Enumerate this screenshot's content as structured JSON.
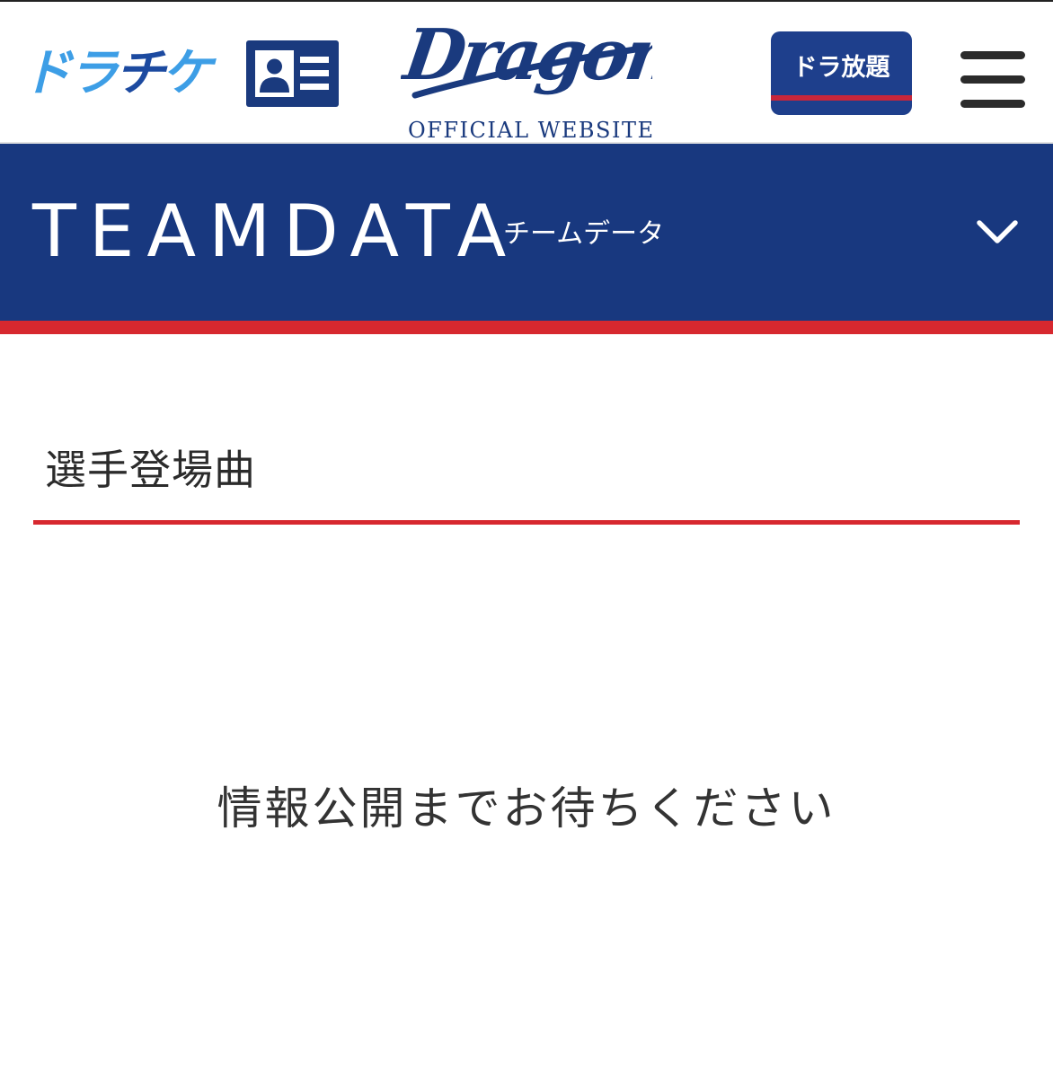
{
  "header": {
    "dorachike_logo": {
      "part1": "ドラ",
      "part2": "チ",
      "part3": "ケ"
    },
    "member_card_icon": "member-card-icon",
    "brand_logo": {
      "script_text": "Dragons",
      "tagline": "OFFICIAL WEBSITE"
    },
    "dora_houdai_label": "ドラ放題",
    "menu_icon": "hamburger-menu-icon"
  },
  "section": {
    "title": "TEAMDATA",
    "subtitle": "チームデータ",
    "toggle_icon": "chevron-down-icon"
  },
  "content": {
    "heading": "選手登場曲",
    "notice": "情報公開までお待ちください"
  },
  "colors": {
    "navy": "#18387f",
    "red": "#d7282f",
    "light_blue": "#3d9ee6",
    "text": "#2b2b2b"
  }
}
